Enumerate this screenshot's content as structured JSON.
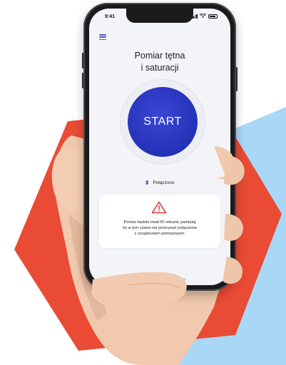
{
  "colors": {
    "hexagon": "#e94b35",
    "accent_blue": "#2431b8",
    "light_blue": "#a8d8f5",
    "warning_red": "#d9382c"
  },
  "status_bar": {
    "time": "9:41"
  },
  "header": {
    "menu_icon": "hamburger-menu-icon",
    "title": "Pomiar tętna\ni saturacji"
  },
  "start": {
    "label": "START"
  },
  "connection": {
    "icon": "bluetooth-icon",
    "status": "Połączono"
  },
  "warning": {
    "icon": "warning-triangle-icon",
    "message": "Pomiar będzie trwał 60 sekund, pamiętaj\nby w tym czasie nie przerywać połączenia\nz urządzeniem pomiarowym."
  }
}
